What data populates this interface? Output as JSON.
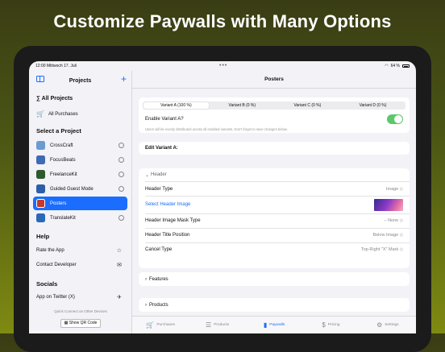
{
  "headline": "Customize Paywalls with Many Options",
  "status": {
    "time": "12:00",
    "date": "Mittwoch 17. Juli",
    "battery": "64 %"
  },
  "sidebar": {
    "title": "Projects",
    "all_projects": "∑ All Projects",
    "all_purchases": "All Purchases",
    "select_heading": "Select a Project",
    "projects": [
      {
        "label": "CrossCraft",
        "color": "#6b9ccf"
      },
      {
        "label": "FocusBeats",
        "color": "#3f6ab5"
      },
      {
        "label": "FreelanceKit",
        "color": "#2f5a2f"
      },
      {
        "label": "Guided Guest Mode",
        "color": "#2d5fa8"
      },
      {
        "label": "Posters",
        "color": "#c23a2a"
      },
      {
        "label": "TranslateKit",
        "color": "#2a68b8"
      }
    ],
    "help_heading": "Help",
    "rate": "Rate the App",
    "contact": "Contact Developer",
    "socials_heading": "Socials",
    "twitter": "App on Twitter (X)",
    "quick_connect": "Quick Connect on Other Devices",
    "qr_button": "Show QR Code"
  },
  "main": {
    "title": "Posters",
    "variants": [
      "Variant A (100 %)",
      "Variant B (0 %)",
      "Variant C (0 %)",
      "Variant D (0 %)"
    ],
    "enable_label": "Enable Variant A?",
    "enable_note": "Users will be evenly distributed across all enabled variants. Don't forget to save changes below.",
    "edit_label": "Edit Variant A:",
    "header_section": "Header",
    "header_type": {
      "label": "Header Type",
      "value": "Image ◇"
    },
    "select_image": "Select Header Image",
    "mask_type": {
      "label": "Header Image Mask Type",
      "value": "– None ◇"
    },
    "title_position": {
      "label": "Header Title Position",
      "value": "Below Image ◇"
    },
    "cancel_type": {
      "label": "Cancel Type",
      "value": "Top-Right \"X\" Mark ◇"
    },
    "features": "Features",
    "products": "Products"
  },
  "tabs": [
    {
      "label": "Purchases",
      "icon": "🛒"
    },
    {
      "label": "Products",
      "icon": "☰"
    },
    {
      "label": "Paywalls",
      "icon": "▮"
    },
    {
      "label": "Pricing",
      "icon": "$"
    },
    {
      "label": "Settings",
      "icon": "⚙"
    }
  ],
  "accent": "#1a6dff"
}
